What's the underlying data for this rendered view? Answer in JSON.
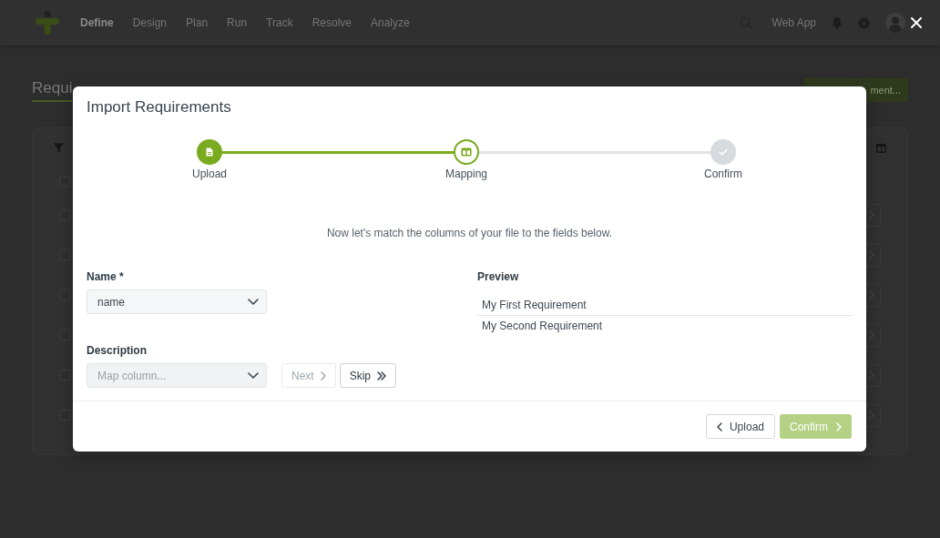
{
  "nav": {
    "items": [
      {
        "label": "Define",
        "selected": true
      },
      {
        "label": "Design",
        "selected": false
      },
      {
        "label": "Plan",
        "selected": false
      },
      {
        "label": "Run",
        "selected": false
      },
      {
        "label": "Track",
        "selected": false
      },
      {
        "label": "Resolve",
        "selected": false
      },
      {
        "label": "Analyze",
        "selected": false
      }
    ],
    "app_label": "Web App"
  },
  "page": {
    "title": "Requi",
    "action_button": "ment...",
    "table": {
      "header_checked": false,
      "rows": [
        {
          "checked": false
        },
        {
          "checked": false
        },
        {
          "checked": false
        },
        {
          "checked": false
        },
        {
          "checked": false
        },
        {
          "checked": false
        }
      ]
    }
  },
  "modal": {
    "title": "Import Requirements",
    "steps": [
      {
        "kind": "upload",
        "label": "Upload",
        "completed": true,
        "selected": false
      },
      {
        "kind": "mapping",
        "label": "Mapping",
        "completed": false,
        "selected": true
      },
      {
        "kind": "confirm",
        "label": "Confirm",
        "completed": false,
        "selected": false
      }
    ],
    "instruction": "Now let's match the columns of your file to the fields below.",
    "fields": [
      {
        "label": "Name *",
        "value": "name"
      },
      {
        "label": "Description",
        "placeholder": "Map column...",
        "actions": [
          {
            "kind": "next",
            "label": "Next",
            "disabled": true
          },
          {
            "kind": "skip",
            "label": "Skip",
            "disabled": false
          }
        ]
      }
    ],
    "preview": {
      "title": "Preview",
      "rows": [
        "My First Requirement",
        "My Second Requirement"
      ]
    },
    "back_button": {
      "label": "Upload"
    },
    "confirm_button": {
      "label": "Confirm",
      "disabled": true
    }
  }
}
